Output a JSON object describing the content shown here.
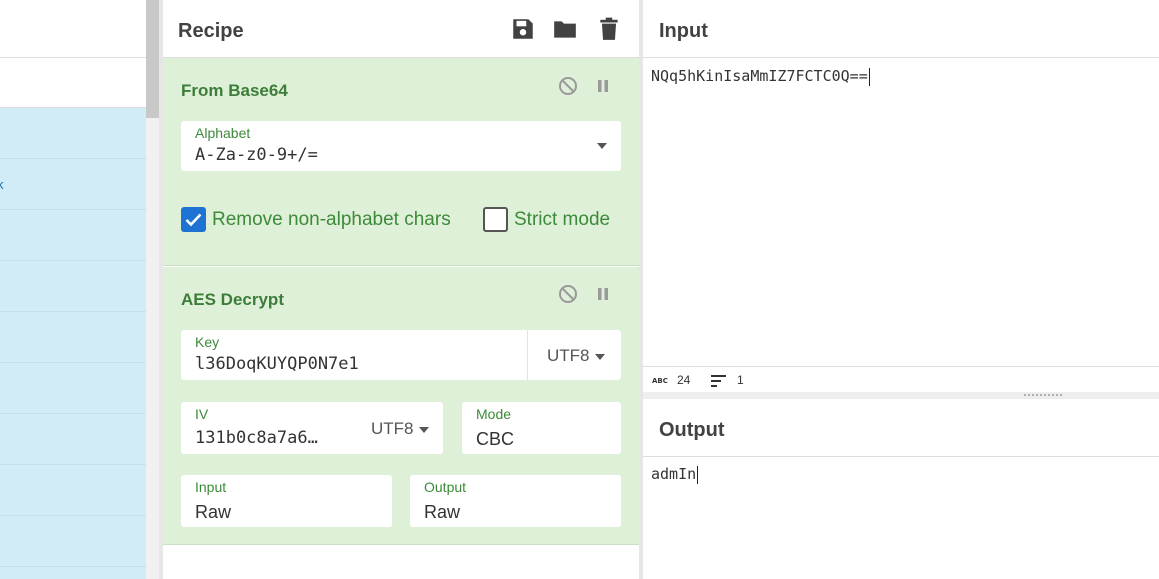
{
  "recipe": {
    "title": "Recipe",
    "operations": [
      {
        "name": "From Base64",
        "alphabet_label": "Alphabet",
        "alphabet_value": "A-Za-z0-9+/=",
        "remove_non_alphabet_label": "Remove non-alphabet chars",
        "remove_non_alphabet_checked": true,
        "strict_mode_label": "Strict mode",
        "strict_mode_checked": false
      },
      {
        "name": "AES Decrypt",
        "key_label": "Key",
        "key_value": "l36DoqKUYQP0N7e1",
        "key_encoding": "UTF8",
        "iv_label": "IV",
        "iv_value": "131b0c8a7a6…",
        "iv_encoding": "UTF8",
        "mode_label": "Mode",
        "mode_value": "CBC",
        "input_label": "Input",
        "input_value": "Raw",
        "output_label": "Output",
        "output_value": "Raw"
      }
    ]
  },
  "input": {
    "title": "Input",
    "text": "NQq5hKinIsaMmIZ7FCTC0Q==",
    "stats": {
      "length": "24",
      "lines": "1"
    }
  },
  "output": {
    "title": "Output",
    "text": "admIn"
  },
  "colors": {
    "op_background": "#dff0d8",
    "op_title": "#3d7d3a",
    "checkbox_on": "#1e73d2",
    "operations_list": "#d1ecf7"
  }
}
